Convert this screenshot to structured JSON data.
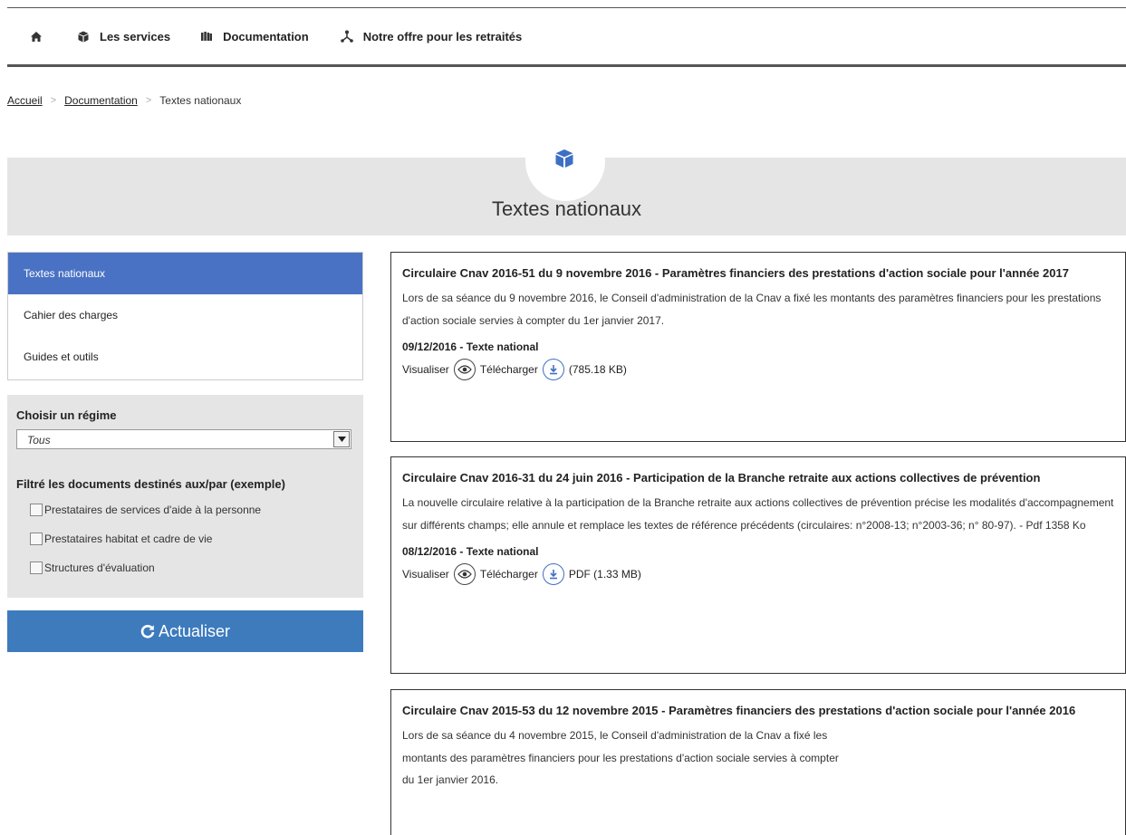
{
  "nav": {
    "items": [
      {
        "label": "Les services",
        "icon": "cube-icon"
      },
      {
        "label": "Documentation",
        "icon": "books-icon"
      },
      {
        "label": "Notre offre pour les retraités",
        "icon": "network-icon"
      }
    ]
  },
  "breadcrumb": {
    "items": [
      "Accueil",
      "Documentation"
    ],
    "current": "Textes nationaux"
  },
  "banner": {
    "title": "Textes nationaux",
    "icon": "cube-icon"
  },
  "sidebar": {
    "items": [
      {
        "label": "Textes nationaux",
        "active": true
      },
      {
        "label": "Cahier des charges",
        "active": false
      },
      {
        "label": "Guides et outils",
        "active": false
      }
    ]
  },
  "filters": {
    "regime_label": "Choisir un régime",
    "regime_value": "Tous",
    "docs_label": "Filtré les documents destinés aux/par (exemple)",
    "options": [
      {
        "label": "Prestataires de services d'aide à la personne",
        "checked": false
      },
      {
        "label": "Prestataires habitat et cadre de vie",
        "checked": false
      },
      {
        "label": "Structures d'évaluation",
        "checked": false
      }
    ],
    "refresh_label": "Actualiser"
  },
  "results": [
    {
      "title": "Circulaire Cnav 2016-51 du 9 novembre 2016 - Paramètres financiers des prestations d'action sociale pour l'année 2017",
      "description": "Lors de sa séance du 9 novembre 2016, le Conseil d'administration de la Cnav a fixé les montants des paramètres financiers pour les prestations d'action sociale servies à compter du 1er janvier 2017.",
      "meta": "09/12/2016 - Texte national",
      "view_label": "Visualiser",
      "download_label": "Télécharger",
      "file_info": "(785.18 KB)"
    },
    {
      "title": "Circulaire Cnav 2016-31 du 24 juin 2016 - Participation de la Branche retraite aux actions collectives de prévention",
      "description": "La nouvelle circulaire relative à la participation de la Branche retraite aux actions collectives de prévention précise les modalités d'accompagnement sur différents champs; elle annule et remplace les textes de référence précédents (circulaires: n°2008-13; n°2003-36; n° 80-97). - Pdf 1358 Ko",
      "meta": "08/12/2016 - Texte national",
      "view_label": "Visualiser",
      "download_label": "Télécharger",
      "file_info": "PDF (1.33 MB)"
    },
    {
      "title": "Circulaire Cnav 2015-53 du 12 novembre 2015 - Paramètres financiers des prestations d'action sociale pour l'année 2016",
      "description_lines": [
        "Lors de sa séance du 4 novembre 2015, le Conseil d'administration de la Cnav a fixé les",
        "montants des paramètres financiers pour les prestations d'action sociale servies à compter",
        "du 1er janvier 2016."
      ]
    }
  ],
  "colors": {
    "accent": "#4a72c4",
    "button": "#3d7bbd",
    "panel": "#e5e5e5"
  }
}
